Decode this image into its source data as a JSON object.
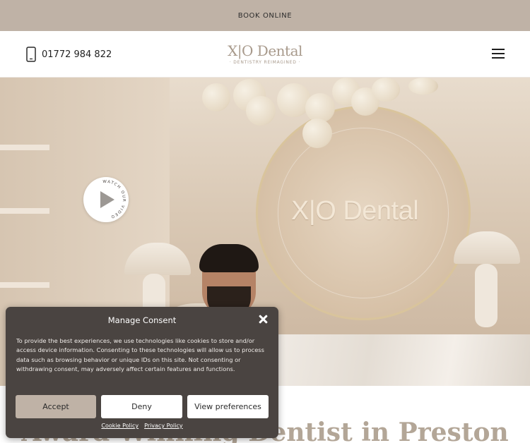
{
  "topbar": {
    "book_label": "BOOK ONLINE"
  },
  "header": {
    "phone": "01772 984 822",
    "logo": {
      "name": "X|O Dental",
      "tagline": "· DENTISTRY REIMAGINED ·"
    }
  },
  "hero": {
    "sign_text": "X|O Dental",
    "video_badge": "WATCH OUR VIDEO"
  },
  "main": {
    "heading": "Award Winning Dentist in Preston"
  },
  "consent": {
    "title": "Manage Consent",
    "body": "To provide the best experiences, we use technologies like cookies to store and/or access device information. Consenting to these technologies will allow us to process data such as browsing behavior or unique IDs on this site. Not consenting or withdrawing consent, may adversely affect certain features and functions.",
    "accept_label": "Accept",
    "deny_label": "Deny",
    "preferences_label": "View preferences",
    "links": [
      "Cookie Policy",
      "Privacy Policy"
    ]
  }
}
